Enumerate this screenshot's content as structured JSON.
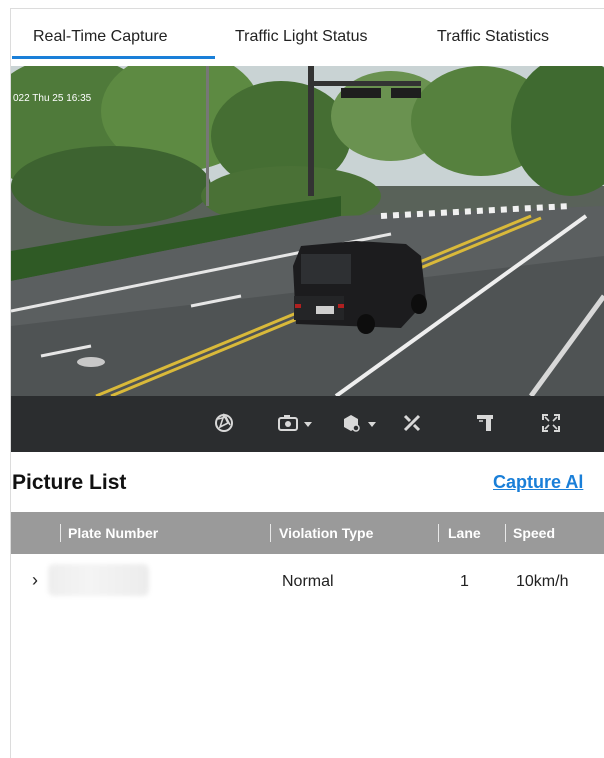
{
  "tabs": [
    {
      "label": "Real-Time Capture",
      "active": true
    },
    {
      "label": "Traffic Light Status",
      "active": false
    },
    {
      "label": "Traffic Statistics",
      "active": false
    }
  ],
  "video": {
    "osd_timestamp": "022 Thu 25 16:35",
    "toolbar_icons": [
      "capture-icon",
      "camera-icon",
      "recognition-icon",
      "tools-icon",
      "lane-icon",
      "fullscreen-icon"
    ]
  },
  "picture_list": {
    "title": "Picture List",
    "capture_link": "Capture Al",
    "columns": [
      "Plate Number",
      "Violation Type",
      "Lane",
      "Speed"
    ],
    "rows": [
      {
        "plate": "",
        "violation": "Normal",
        "lane": "1",
        "speed": "10km/h"
      }
    ]
  },
  "colors": {
    "accent": "#1a7fd8",
    "toolbar_bg": "#2b2d2f",
    "header_bg": "#9a9a9a"
  }
}
